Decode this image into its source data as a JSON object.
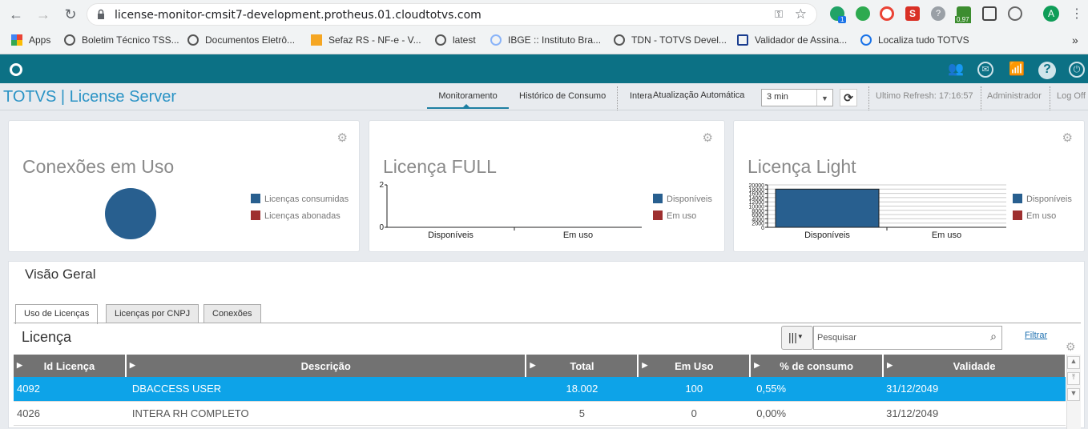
{
  "browser": {
    "url": "license-monitor-cmsit7-development.protheus.01.cloudtotvs.com",
    "ext_badge_1": "1",
    "ext_badge_2": "0,97",
    "profile_initial": "A",
    "bookmarks": [
      "Apps",
      "Boletim Técnico TSS...",
      "Documentos Eletrô...",
      "Sefaz RS - NF-e - V...",
      "latest",
      "IBGE :: Instituto Bra...",
      "TDN - TOTVS Devel...",
      "Validador de Assina...",
      "Localiza tudo TOTVS"
    ],
    "bookmarks_more": "»"
  },
  "app": {
    "brand": "TOTVS | License Server",
    "menu": {
      "monitoramento": "Monitoramento",
      "historico": "Histórico de Consumo",
      "intera": "Intera",
      "atualizacao": "Atualização Automática",
      "refresh_value": "3 min",
      "ultimo_refresh": "Ultimo Refresh: 17:16:57",
      "user": "Administrador",
      "logoff": "Log Off"
    }
  },
  "cards": {
    "conexoes": {
      "title": "Conexões em Uso",
      "legend": [
        "Licenças consumidas",
        "Licenças abonadas"
      ]
    },
    "full": {
      "title": "Licença FULL",
      "legend": [
        "Disponíveis",
        "Em uso"
      ]
    },
    "light": {
      "title": "Licença Light",
      "legend": [
        "Disponíveis",
        "Em uso"
      ]
    }
  },
  "colors": {
    "series_primary": "#285f8f",
    "series_secondary": "#9e2f2f",
    "accent": "#0c7185",
    "selected_row": "#0da3e8"
  },
  "chart_data": [
    {
      "type": "pie",
      "title": "Conexões em Uso",
      "categories": [
        "Licenças consumidas",
        "Licenças abonadas"
      ],
      "values": [
        100,
        0
      ]
    },
    {
      "type": "bar",
      "title": "Licença FULL",
      "categories": [
        "Disponíveis",
        "Em uso"
      ],
      "values": [
        0,
        0
      ],
      "ylim": [
        0,
        2
      ],
      "yticks": [
        "2",
        "0"
      ]
    },
    {
      "type": "bar",
      "title": "Licença Light",
      "categories": [
        "Disponíveis",
        "Em uso"
      ],
      "values": [
        18000,
        0
      ],
      "ylim": [
        0,
        20000
      ],
      "yticks": [
        "20000",
        "18000",
        "16000",
        "14000",
        "12000",
        "10000",
        "8000",
        "6000",
        "4000",
        "2000",
        "0"
      ]
    }
  ],
  "overview": {
    "title": "Visão Geral",
    "tabs": [
      "Uso de Licenças",
      "Licenças por CNPJ",
      "Conexões"
    ],
    "section_title": "Licença",
    "search_placeholder": "Pesquisar",
    "filter_label": "Filtrar",
    "columns": [
      "Id Licença",
      "Descrição",
      "Total",
      "Em Uso",
      "% de consumo",
      "Validade"
    ],
    "rows": [
      [
        "4092",
        "DBACCESS USER",
        "18.002",
        "100",
        "0,55%",
        "31/12/2049"
      ],
      [
        "4026",
        "INTERA RH COMPLETO",
        "5",
        "0",
        "0,00%",
        "31/12/2049"
      ]
    ]
  }
}
